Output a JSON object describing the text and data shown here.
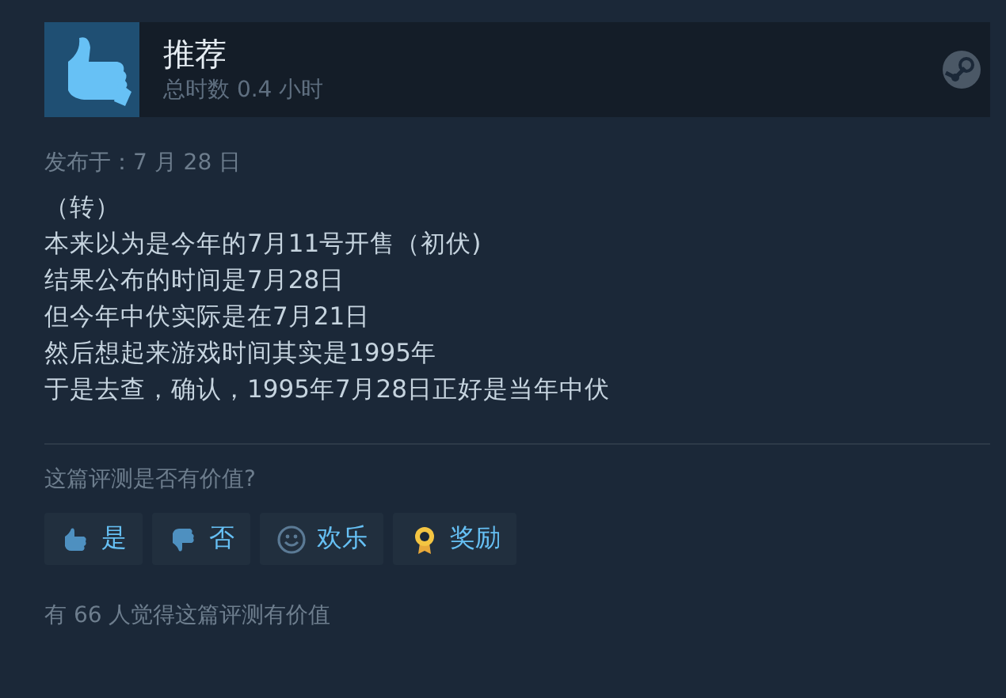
{
  "review": {
    "verdict": "推荐",
    "playtime": "总时数 0.4 小时",
    "posted": "发布于：7 月 28 日",
    "body": [
      "（转）",
      "本来以为是今年的7月11号开售（初伏)",
      "结果公布的时间是7月28日",
      "但今年中伏实际是在7月21日",
      "然后想起来游戏时间其实是1995年",
      "于是去查，确认，1995年7月28日正好是当年中伏"
    ]
  },
  "helpful": {
    "question": "这篇评测是否有价值?",
    "buttons": [
      {
        "kind": "yes",
        "label": "是"
      },
      {
        "kind": "no",
        "label": "否"
      },
      {
        "kind": "funny",
        "label": "欢乐"
      },
      {
        "kind": "award",
        "label": "奖励"
      }
    ],
    "summary": "有 66 人觉得这篇评测有价值"
  }
}
